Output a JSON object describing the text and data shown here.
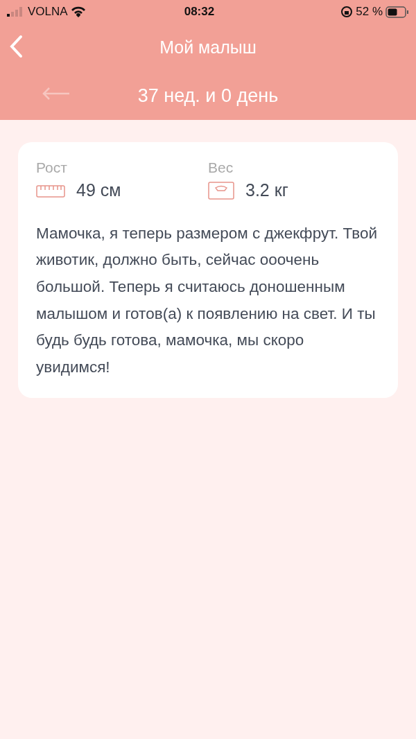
{
  "status_bar": {
    "carrier": "VOLNA",
    "time": "08:32",
    "battery": "52 %"
  },
  "header": {
    "title": "Мой малыш"
  },
  "week_nav": {
    "label": "37 нед. и 0 день",
    "previous_disabled": true
  },
  "metrics": [
    {
      "kind": "ruler",
      "label": "Рост",
      "value": "49 см"
    },
    {
      "kind": "scale",
      "label": "Вес",
      "value": "3.2 кг"
    }
  ],
  "description": "Мамочка, я теперь размером с джекфрут. Твой животик, должно быть, сейчас ооочень большой. Теперь я считаюсь доношенным малышом и готов(а) к появлению на свет. И ты будь будь готова, мамочка, мы скоро увидимся!"
}
